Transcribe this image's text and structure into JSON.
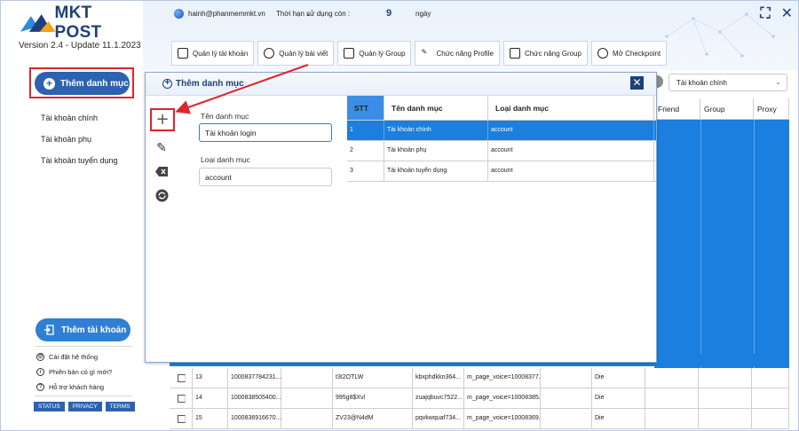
{
  "app": {
    "logo_text": "MKT POST",
    "version": "Version 2.4 - Update 11.1.2023"
  },
  "header": {
    "email": "hainh@phanmemmkt.vn",
    "expiry_label": "Thời hạn sử dụng còn :",
    "expiry_value": "9",
    "expiry_unit": "ngày",
    "tabs": [
      {
        "label": "Quản lý tài khoản"
      },
      {
        "label": "Quản lý bài viết"
      },
      {
        "label": "Quản lý Group"
      },
      {
        "label": "Chức năng Profile"
      },
      {
        "label": "Chức năng Group"
      },
      {
        "label": "Mở Checkpoint"
      }
    ]
  },
  "sidebar": {
    "add_category_label": "Thêm danh mục",
    "categories": [
      "Tài khoản chính",
      "Tài khoản phụ",
      "Tài khoản tuyển dụng"
    ],
    "add_account_label": "Thêm tài khoản",
    "links": [
      {
        "label": "Cài đặt hệ thống"
      },
      {
        "label": "Phiên bản có gì mới?"
      },
      {
        "label": "Hỗ trợ khách hàng"
      }
    ],
    "badges": [
      "STATUS",
      "PRIVACY",
      "TERMS"
    ]
  },
  "background": {
    "select_value": "Tài khoản chính",
    "grid_headers": [
      "Friend",
      "Group",
      "Proxy"
    ],
    "rows": [
      {
        "stt": "13",
        "uid": "1000837784231...",
        "pass": "t3I2OTLW",
        "code": "kbxphdkkn364...",
        "page": "m_page_voice=10008377...",
        "status": "Die"
      },
      {
        "stt": "14",
        "uid": "1000838505400...",
        "pass": "995g8$Xvl",
        "code": "zuajqbuvc7522...",
        "page": "m_page_voice=10008385...",
        "status": "Die"
      },
      {
        "stt": "15",
        "uid": "1000836916670...",
        "pass": "ZV23@N4dM",
        "code": "pqvkwquaf734...",
        "page": "m_page_voice=10008369...",
        "status": "Die"
      }
    ]
  },
  "modal": {
    "title": "Thêm  danh mục",
    "name_label": "Tên danh mục",
    "name_value": "Tài khoản login",
    "type_label": "Loại danh mục",
    "type_value": "account",
    "table_headers": [
      "STT",
      "Tên danh mục",
      "Loại danh mục"
    ],
    "table_rows": [
      {
        "stt": "1",
        "name": "Tài khoản chính",
        "type": "account"
      },
      {
        "stt": "2",
        "name": "Tài khoản phụ",
        "type": "account"
      },
      {
        "stt": "3",
        "name": "Tài khoản tuyển dụng",
        "type": "account"
      }
    ]
  },
  "colors": {
    "brand": "#1f3f7a",
    "accent": "#2c62b0",
    "selection": "#1a7fde",
    "highlight": "#e0242b"
  }
}
